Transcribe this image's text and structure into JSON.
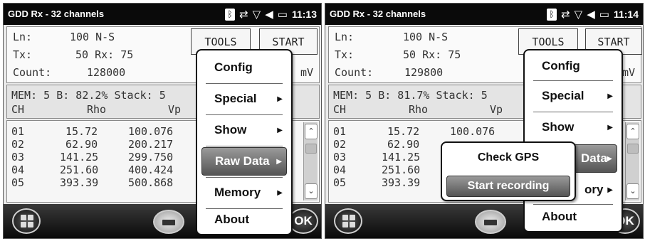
{
  "screens": [
    {
      "status": {
        "title": "GDD Rx - 32 channels",
        "bluetooth_icon": "bluetooth-icon",
        "sync_icon": "sync-icon",
        "signal_icon": "no-signal-icon",
        "volume_icon": "volume-icon",
        "battery_icon": "battery-icon",
        "time": "11:13"
      },
      "info": {
        "ln_label": "Ln:",
        "ln_value": "100 N-S",
        "tx_label": "Tx:",
        "tx_value": "50 Rx: 75",
        "count_label": "Count:",
        "count_value": "128000",
        "unit": "mV"
      },
      "buttons": {
        "tools": "TOOLS",
        "start": "START"
      },
      "mem_line": "MEM: 5 B: 82.2% Stack: 5",
      "headers": {
        "ch": "CH",
        "rho": "Rho",
        "vp": "Vp"
      },
      "rows": [
        {
          "ch": "01",
          "rho": "15.72",
          "vp": "100.076"
        },
        {
          "ch": "02",
          "rho": "62.90",
          "vp": "200.217"
        },
        {
          "ch": "03",
          "rho": "141.25",
          "vp": "299.750"
        },
        {
          "ch": "04",
          "rho": "251.60",
          "vp": "400.424"
        },
        {
          "ch": "05",
          "rho": "393.39",
          "vp": "500.868"
        }
      ],
      "menu": [
        "Config",
        "Special",
        "Show",
        "Raw Data",
        "Memory",
        "About"
      ],
      "taskbar": {
        "ok": "OK"
      }
    },
    {
      "status": {
        "title": "GDD Rx - 32 channels",
        "bluetooth_icon": "bluetooth-icon",
        "sync_icon": "sync-icon",
        "signal_icon": "no-signal-icon",
        "volume_icon": "volume-icon",
        "battery_icon": "battery-icon",
        "time": "11:14"
      },
      "info": {
        "ln_label": "Ln:",
        "ln_value": "100 N-S",
        "tx_label": "Tx:",
        "tx_value": "50 Rx: 75",
        "count_label": "Count:",
        "count_value": "129800",
        "unit": "mV"
      },
      "buttons": {
        "tools": "TOOLS",
        "start": "START"
      },
      "mem_line": "MEM: 5 B: 81.7% Stack: 5",
      "headers": {
        "ch": "CH",
        "rho": "Rho",
        "vp": "Vp"
      },
      "rows": [
        {
          "ch": "01",
          "rho": "15.72",
          "vp": "100.076"
        },
        {
          "ch": "02",
          "rho": "62.90",
          "vp": ""
        },
        {
          "ch": "03",
          "rho": "141.25",
          "vp": ""
        },
        {
          "ch": "04",
          "rho": "251.60",
          "vp": ""
        },
        {
          "ch": "05",
          "rho": "393.39",
          "vp": ""
        }
      ],
      "menu": [
        "Config",
        "Special",
        "Show",
        "Data",
        "ory",
        "About"
      ],
      "submenu": [
        "Check GPS",
        "Start recording"
      ],
      "taskbar": {
        "ok": "OK"
      }
    }
  ]
}
